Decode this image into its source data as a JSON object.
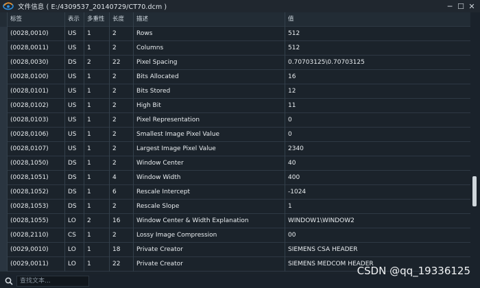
{
  "window": {
    "title": "文件信息 ( E:/4309537_20140729/CT70.dcm )",
    "minimize": "─",
    "maximize": "☐",
    "close": "✕"
  },
  "table": {
    "columns": [
      "标签",
      "表示",
      "多重性",
      "长度",
      "描述",
      "值"
    ],
    "rows": [
      [
        "(0028,0010)",
        "US",
        "1",
        "2",
        "Rows",
        "512"
      ],
      [
        "(0028,0011)",
        "US",
        "1",
        "2",
        "Columns",
        "512"
      ],
      [
        "(0028,0030)",
        "DS",
        "2",
        "22",
        "Pixel Spacing",
        "0.70703125\\0.70703125"
      ],
      [
        "(0028,0100)",
        "US",
        "1",
        "2",
        "Bits Allocated",
        "16"
      ],
      [
        "(0028,0101)",
        "US",
        "1",
        "2",
        "Bits Stored",
        "12"
      ],
      [
        "(0028,0102)",
        "US",
        "1",
        "2",
        "High Bit",
        "11"
      ],
      [
        "(0028,0103)",
        "US",
        "1",
        "2",
        "Pixel Representation",
        "0"
      ],
      [
        "(0028,0106)",
        "US",
        "1",
        "2",
        "Smallest Image Pixel Value",
        "0"
      ],
      [
        "(0028,0107)",
        "US",
        "1",
        "2",
        "Largest Image Pixel Value",
        "2340"
      ],
      [
        "(0028,1050)",
        "DS",
        "1",
        "2",
        "Window Center",
        "40"
      ],
      [
        "(0028,1051)",
        "DS",
        "1",
        "4",
        "Window Width",
        "400"
      ],
      [
        "(0028,1052)",
        "DS",
        "1",
        "6",
        "Rescale Intercept",
        "-1024"
      ],
      [
        "(0028,1053)",
        "DS",
        "1",
        "2",
        "Rescale Slope",
        "1"
      ],
      [
        "(0028,1055)",
        "LO",
        "2",
        "16",
        "Window Center & Width Explanation",
        "WINDOW1\\WINDOW2"
      ],
      [
        "(0028,2110)",
        "CS",
        "1",
        "2",
        "Lossy Image Compression",
        "00"
      ],
      [
        "(0029,0010)",
        "LO",
        "1",
        "18",
        "Private Creator",
        "SIEMENS CSA HEADER"
      ],
      [
        "(0029,0011)",
        "LO",
        "1",
        "22",
        "Private Creator",
        "SIEMENS MEDCOM HEADER"
      ]
    ]
  },
  "search": {
    "placeholder": "查找文本..."
  },
  "watermark": "CSDN @qq_19336125",
  "colors": {
    "background": "#1a222b",
    "header": "#222c35",
    "grid": "#2e3944",
    "text": "#e9edf0",
    "app_icon_orange": "#e8902a",
    "app_icon_blue": "#2f8fdc"
  },
  "icons": {
    "app": "app-logo-icon",
    "search": "search-icon"
  }
}
